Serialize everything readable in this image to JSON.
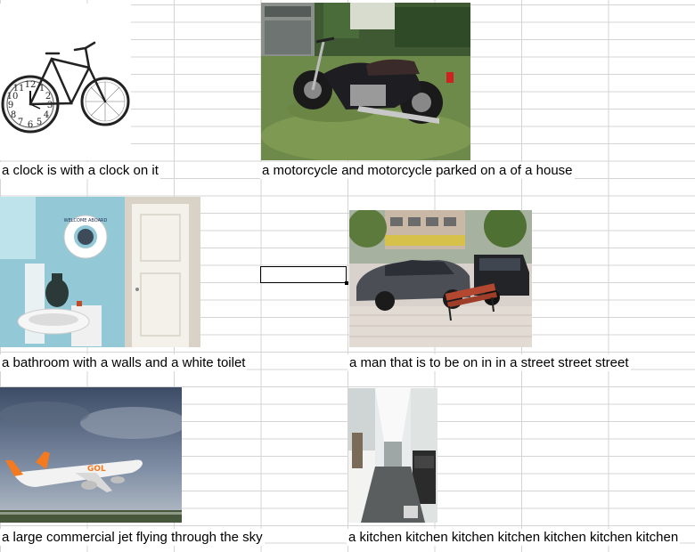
{
  "sheet": {
    "captions": [
      "a clock is with a clock on it",
      "a motorcycle and motorcycle parked on a of a house",
      "a bathroom with a walls and a white toilet",
      "a man that is to be on in in a street street street",
      "a large commercial jet flying through the sky",
      "a kitchen kitchen kitchen kitchen kitchen kitchen kitchen"
    ],
    "images": [
      {
        "subject": "clock-bicycle-image"
      },
      {
        "subject": "motorcycle-image"
      },
      {
        "subject": "bathroom-image"
      },
      {
        "subject": "street-car-image"
      },
      {
        "subject": "airplane-image"
      },
      {
        "subject": "kitchen-image"
      }
    ],
    "plane_livery": "GOL",
    "lifebuoy_text": "WELCOME ABOARD"
  }
}
